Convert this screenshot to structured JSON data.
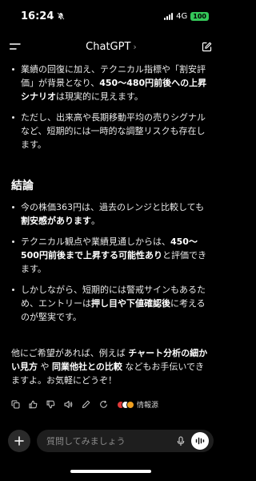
{
  "status_bar": {
    "time": "16:24",
    "network": "4G",
    "battery": "100"
  },
  "nav": {
    "title": "ChatGPT",
    "title_chevron": "›"
  },
  "content": {
    "top_bullets": [
      {
        "pre": "業績の回復に加え、テクニカル指標や「割安評価」が背景となり、",
        "bold": "450〜480円前後への上昇シナリオ",
        "post": "は現実的に見えます。"
      },
      {
        "pre": "ただし、出来高や長期移動平均の売りシグナルなど、短期的には一時的な調整リスクも存在します。",
        "bold": "",
        "post": ""
      }
    ],
    "heading": "結論",
    "conclusion_bullets": [
      {
        "pre": "今の株価363円は、過去のレンジと比較しても",
        "bold": "割安感があります",
        "post": "。"
      },
      {
        "pre": "テクニカル観点や業績見通しからは、",
        "bold": "450〜500円前後まで上昇する可能性あり",
        "post": "と評価できます。"
      },
      {
        "pre": "しかしながら、短期的には警戒サインもあるため、エントリーは",
        "bold": "押し目や下値確認後",
        "post": "に考えるのが堅実です。"
      }
    ],
    "closing": {
      "p1": "他にご希望があれば、例えば ",
      "b1": "チャート分析の細かい見方",
      "p2": " や ",
      "b2": "同業他社との比較",
      "p3": " などもお手伝いできますよ。お気軽にどうぞ！"
    }
  },
  "actions": {
    "icons": [
      "copy-icon",
      "thumbs-up-icon",
      "thumbs-down-icon",
      "speaker-icon",
      "edit-icon",
      "regenerate-icon"
    ],
    "sources_label": "情報源",
    "source_colors": [
      "#e03a3a",
      "#ffffff",
      "#f0a020"
    ]
  },
  "input": {
    "placeholder": "質問してみましょう",
    "value": ""
  },
  "colors": {
    "background": "#000000",
    "battery": "#34c759"
  }
}
